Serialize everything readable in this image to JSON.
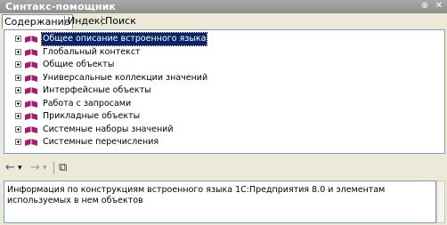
{
  "window": {
    "title": "Синтакс-помощник",
    "pin_glyph": "⊕",
    "close_glyph": "✕"
  },
  "tabs": [
    {
      "label": "Содержание",
      "active": true
    },
    {
      "label": "Индекс",
      "active": false
    },
    {
      "label": "Поиск",
      "active": false
    }
  ],
  "tree": {
    "items": [
      {
        "label": "Общее описание встроенного языка",
        "selected": true
      },
      {
        "label": "Глобальный контекст",
        "selected": false
      },
      {
        "label": "Общие объекты",
        "selected": false
      },
      {
        "label": "Универсальные коллекции значений",
        "selected": false
      },
      {
        "label": "Интерфейсные объекты",
        "selected": false
      },
      {
        "label": "Работа с запросами",
        "selected": false
      },
      {
        "label": "Прикладные объекты",
        "selected": false
      },
      {
        "label": "Системные наборы значений",
        "selected": false
      },
      {
        "label": "Системные перечисления",
        "selected": false
      }
    ],
    "icon": "book-icon",
    "icon_color": "#a0206e"
  },
  "toolbar": {
    "back_icon": "←",
    "back_dropdown": "▾",
    "forward_icon": "→",
    "forward_dropdown": "▾",
    "sync_icon": "⧉"
  },
  "info": {
    "text": "Информация по конструкциям встроенного языка 1С:Предприятия 8.0 и элементам используемых в нем объектов"
  }
}
